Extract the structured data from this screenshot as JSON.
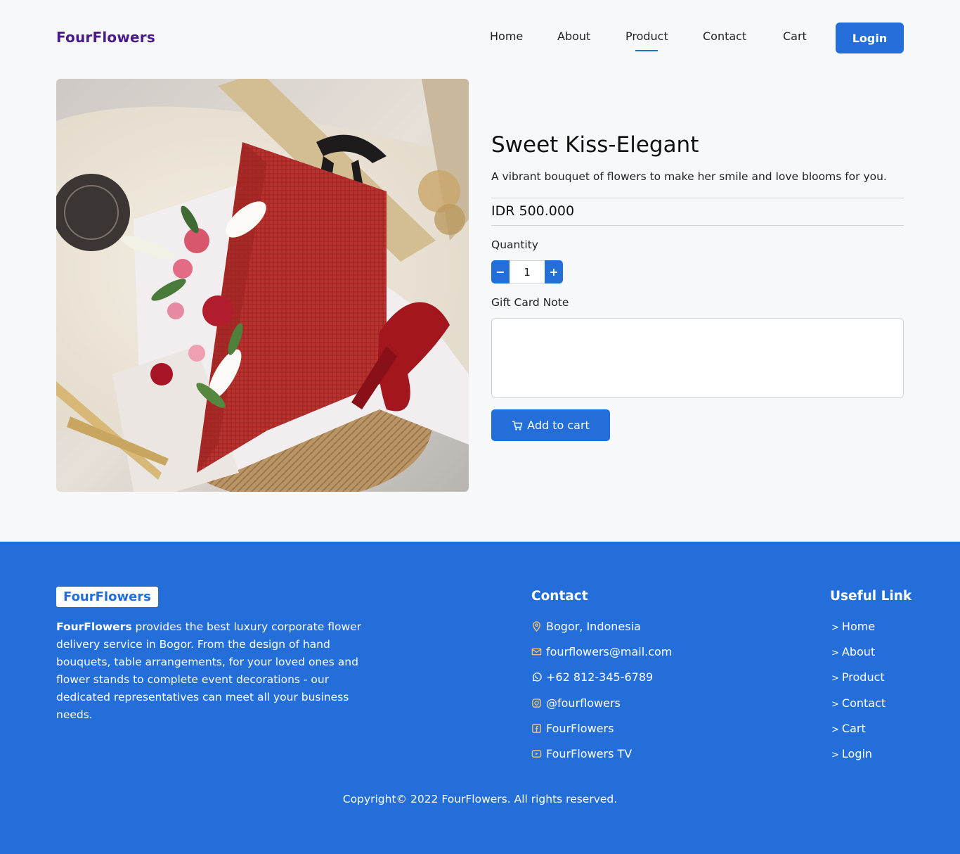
{
  "header": {
    "brand": "FourFlowers",
    "nav": [
      "Home",
      "About",
      "Product",
      "Contact",
      "Cart"
    ],
    "active_nav": "Product",
    "login_label": "Login"
  },
  "product": {
    "title": "Sweet Kiss-Elegant",
    "description": "A vibrant bouquet of flowers to make her smile and love blooms for you.",
    "price": "IDR 500.000",
    "quantity_label": "Quantity",
    "quantity_value": "1",
    "minus_label": "−",
    "plus_label": "+",
    "gift_note_label": "Gift Card Note",
    "gift_note_value": "",
    "add_to_cart_label": "Add to cart",
    "image_icon": "bouquet-photo"
  },
  "footer": {
    "brand": "FourFlowers",
    "about_brand": "FourFlowers",
    "about_text": " provides the best luxury corporate flower delivery service in Bogor. From the design of hand bouquets, table arrangements, for your loved ones and flower stands to complete event decorations - our dedicated representatives can meet all your business needs.",
    "contact_heading": "Contact",
    "contact_items": [
      {
        "icon": "location-icon",
        "text": "Bogor, Indonesia"
      },
      {
        "icon": "mail-icon",
        "text": "fourflowers@mail.com"
      },
      {
        "icon": "whatsapp-icon",
        "text": "+62 812-345-6789"
      },
      {
        "icon": "instagram-icon",
        "text": "@fourflowers"
      },
      {
        "icon": "facebook-icon",
        "text": "FourFlowers"
      },
      {
        "icon": "youtube-icon",
        "text": "FourFlowers TV"
      }
    ],
    "useful_heading": "Useful Link",
    "useful_links": [
      "Home",
      "About",
      "Product",
      "Contact",
      "Cart",
      "Login"
    ],
    "copyright": "Copyright© 2022 FourFlowers. All rights reserved."
  },
  "colors": {
    "primary": "#236ed8",
    "brand": "#4b1a8a",
    "icon_accent": "#f5c26b"
  }
}
